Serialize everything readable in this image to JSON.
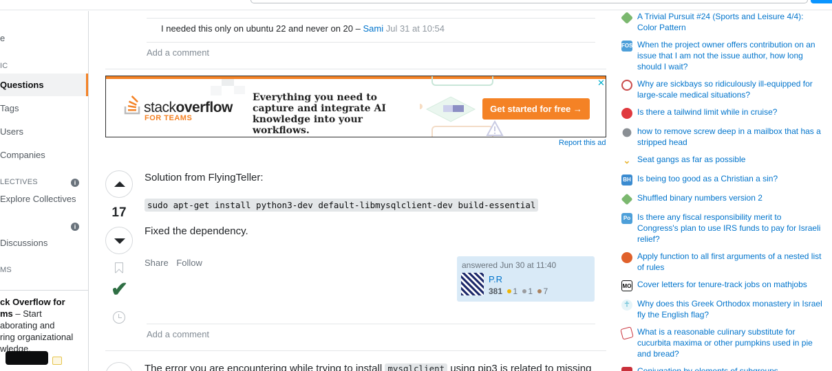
{
  "sidebar": {
    "home_partial": "e",
    "public_header": "IC",
    "questions": "Questions",
    "tags": "Tags",
    "users": "Users",
    "companies": "Companies",
    "collectives_header": "LECTIVES",
    "explore_collectives": "Explore Collectives",
    "discussions": "Discussions",
    "teams_header": "MS",
    "teams_title": "ck Overflow for",
    "teams_title2": "ms",
    "teams_dash": "– Start",
    "teams_line3": "aborating and",
    "teams_line4": "ring organizational",
    "teams_line5": "wledge."
  },
  "comment": {
    "text": "I needed this only on ubuntu 22 and never on 20 –",
    "user": "Sami",
    "time": "Jul 31 at 10:54"
  },
  "add_comment_label": "Add a comment",
  "ad": {
    "logo_a": "stack",
    "logo_b": "overflow",
    "logo_sub": "FOR TEAMS",
    "headline": "Everything you need to capture and integrate AI knowledge into your workflows.",
    "cta": "Get started for free →",
    "close": "✕",
    "report": "Report this ad"
  },
  "answer": {
    "score": "17",
    "intro": "Solution from FlyingTeller:",
    "code": "sudo apt-get install python3-dev default-libmysqlclient-dev build-essential",
    "outro": "Fixed the dependency.",
    "share": "Share",
    "follow": "Follow",
    "answered": "answered Jun 30 at 11:40",
    "user": "P.R",
    "reputation": "381",
    "gold": "1",
    "silver": "1",
    "bronze": "7"
  },
  "next_answer": {
    "text_a": "The error you are encountering while trying to install",
    "code": "mysqlclient",
    "text_b": "using pip3 is related to missing"
  },
  "hot_questions": [
    {
      "icon": "trivia-icon",
      "color": "#7bb86f",
      "text": "A Trivial Pursuit #24 (Sports and Leisure 4/4): Color Pattern"
    },
    {
      "icon": "opensource-icon",
      "color": "#4d9fd9",
      "glyph": "FOS",
      "text": "When the project owner offers contribution on an issue that I am not the issue author, how long should I wait?"
    },
    {
      "icon": "medical-icon",
      "color": "#c94a4a",
      "text": "Why are sickbays so ridiculously ill-equipped for large-scale medical situations?"
    },
    {
      "icon": "aviation-icon",
      "color": "#e0393e",
      "text": "Is there a tailwind limit while in cruise?"
    },
    {
      "icon": "diy-icon",
      "color": "#8a8f94",
      "text": "how to remove screw deep in a mailbox that has a stripped head"
    },
    {
      "icon": "travel-icon",
      "color": "#e9b632",
      "text": "Seat gangs as far as possible"
    },
    {
      "icon": "christianity-icon",
      "color": "#3b8bd0",
      "glyph": "BH",
      "text": "Is being too good as a Christian a sin?"
    },
    {
      "icon": "codegolf-icon",
      "color": "#7bb86f",
      "text": "Shuffled binary numbers version 2"
    },
    {
      "icon": "politics-icon",
      "color": "#4d9fd9",
      "glyph": "Po",
      "text": "Is there any fiscal responsibility merit to Congress's plan to use IRS funds to pay for Israeli relief?"
    },
    {
      "icon": "mathematica-icon",
      "color": "#e0612b",
      "text": "Apply function to all first arguments of a nested list of rules"
    },
    {
      "icon": "academia-icon",
      "color": "#ffffff",
      "glyph": "MO",
      "text": "Cover letters for tenure-track jobs on mathjobs"
    },
    {
      "icon": "history-icon",
      "color": "#6fc3d8",
      "text": "Why does this Greek Orthodox monastery in Israel fly the English flag?"
    },
    {
      "icon": "cooking-icon",
      "color": "#c9303a",
      "text": "What is a reasonable culinary substitute for cucurbita maxima or other pumpkins used in pie and bread?"
    },
    {
      "icon": "math-icon",
      "color": "#c9303a",
      "text": "Conjugation by elements of subgroups"
    }
  ]
}
